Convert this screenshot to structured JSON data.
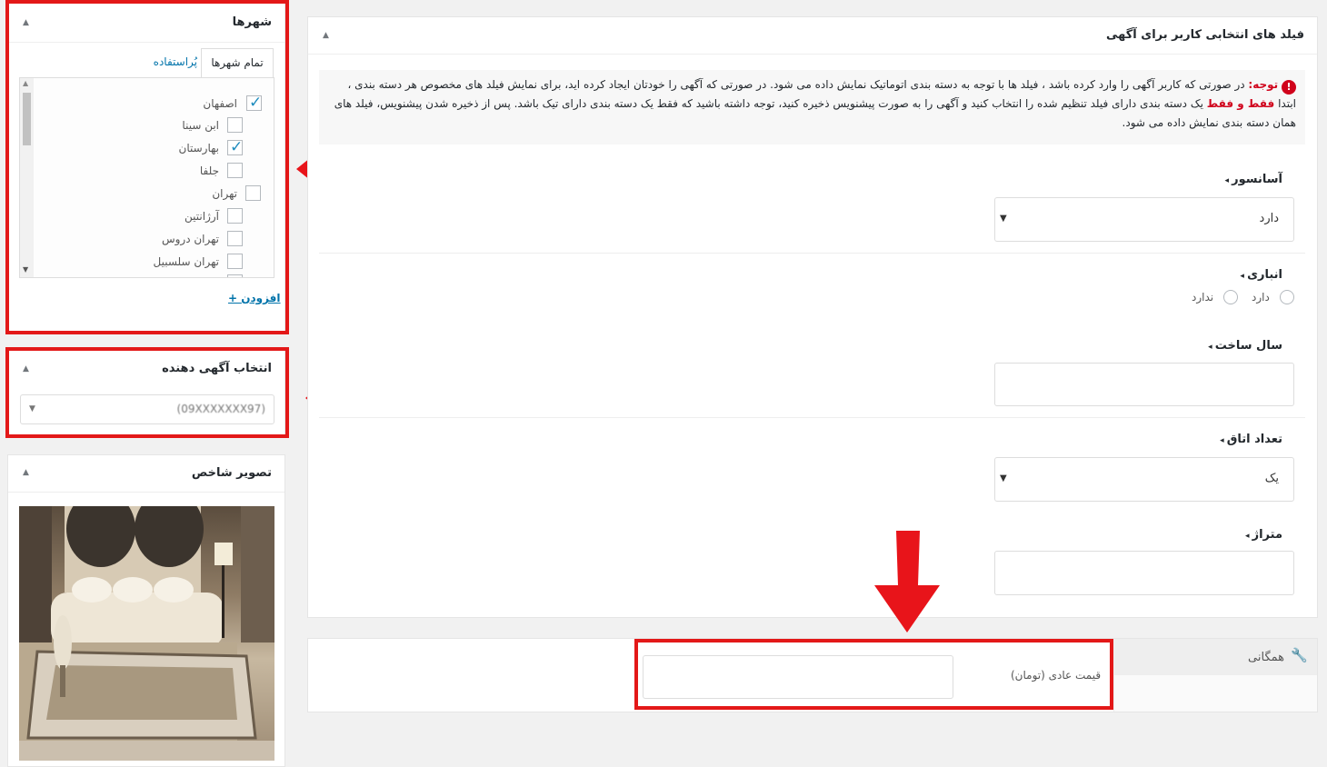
{
  "cities_box": {
    "title": "شهرها",
    "tab_all": "تمام شهرها",
    "tab_used": "پُراستفاده",
    "items": [
      {
        "label": "اصفهان",
        "checked": true
      },
      {
        "label": "ابن سینا",
        "checked": false
      },
      {
        "label": "بهارستان",
        "checked": true
      },
      {
        "label": "جلفا",
        "checked": false
      },
      {
        "label": "تهران",
        "checked": false
      },
      {
        "label": "آرژانتین",
        "checked": false
      },
      {
        "label": "تهران دروس",
        "checked": false
      },
      {
        "label": "تهران سلسبیل",
        "checked": false
      }
    ],
    "add_link": "+ افزودن"
  },
  "advertiser_box": {
    "title": "انتخاب آگهی دهنده",
    "selected": "(09XXXXXXX97)"
  },
  "featured_box": {
    "title": "تصویر شاخص"
  },
  "fields_box": {
    "title": "فیلد های انتخابی کاربر برای آگهی",
    "notice_prefix": "توجه:",
    "notice_part1": " در صورتی که کاربر آگهی را وارد کرده باشد ، فیلد ها با توجه به دسته بندی اتوماتیک نمایش داده می شود. در صورتی که آگهی را خودتان ایجاد کرده اید، برای نمایش فیلد های مخصوص هر دسته بندی ، ابتدا ",
    "notice_emphasis": "فقط و فقط",
    "notice_part2": " یک دسته بندی دارای فیلد تنظیم شده را انتخاب کنید و آگهی را به صورت پیشنویس ذخیره کنید، توجه داشته باشید که فقط یک دسته بندی دارای تیک باشد. پس از ذخیره شدن پیشنویس، فیلد های همان دسته بندی نمایش داده می شود.",
    "elevator_label": "آسانسور",
    "elevator_value": "دارد",
    "storage_label": "انباری",
    "storage_opt_yes": "دارد",
    "storage_opt_no": "ندارد",
    "year_label": "سال ساخت",
    "rooms_label": "تعداد اتاق",
    "rooms_value": "یک",
    "area_label": "متراژ"
  },
  "general_box": {
    "tab_label": "همگانی",
    "price_label": "قیمت عادی (تومان)"
  },
  "colors": {
    "highlight": "#e31818",
    "link": "#0073aa",
    "notice_bg": "#f7f7f7"
  }
}
